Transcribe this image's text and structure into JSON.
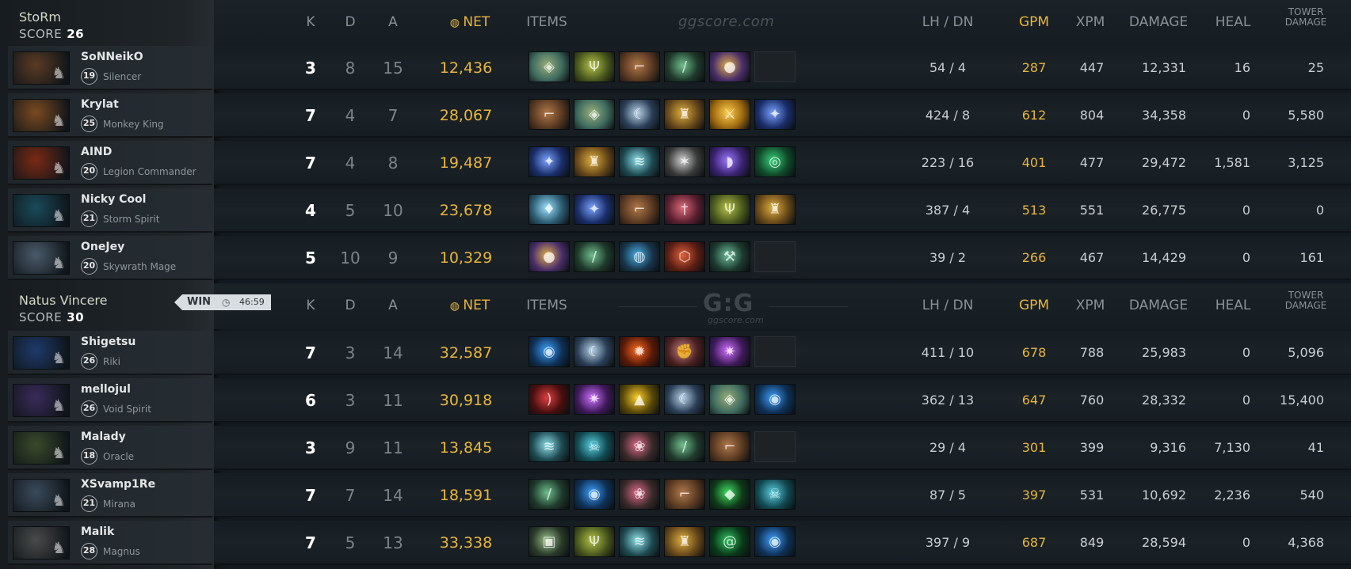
{
  "teams": [
    {
      "name": "StoRm",
      "score_label": "SCORE",
      "score": "26",
      "players": [
        {
          "name": "SoNNeikO",
          "level": "19",
          "hero": "Silencer",
          "k": "3",
          "d": "8",
          "a": "15",
          "net": "12,436",
          "lhdn": "54 / 4",
          "gpm": "287",
          "xpm": "447",
          "damage": "12,331",
          "heal": "16",
          "tower": "25",
          "items": [
            "staff-item-icon",
            "trident-item-icon",
            "boots-item-icon",
            "wand-item-icon",
            "orb-item-icon",
            "empty"
          ]
        },
        {
          "name": "Krylat",
          "level": "25",
          "hero": "Monkey King",
          "k": "7",
          "d": "4",
          "a": "7",
          "net": "28,067",
          "lhdn": "424 / 8",
          "gpm": "612",
          "xpm": "804",
          "damage": "34,358",
          "heal": "0",
          "tower": "5,580",
          "items": [
            "boots-item-icon",
            "staff-item-icon",
            "axe-item-icon",
            "helm-item-icon",
            "sword-item-icon",
            "scepter-item-icon"
          ]
        },
        {
          "name": "AIND",
          "level": "20",
          "hero": "Legion Commander",
          "k": "7",
          "d": "4",
          "a": "8",
          "net": "19,487",
          "lhdn": "223 / 16",
          "gpm": "401",
          "xpm": "477",
          "damage": "29,472",
          "heal": "1,581",
          "tower": "3,125",
          "items": [
            "scepter-item-icon",
            "helm-item-icon",
            "blade-item-icon",
            "wing-item-icon",
            "cloak-item-icon",
            "ring-item-icon"
          ]
        },
        {
          "name": "Nicky Cool",
          "level": "21",
          "hero": "Storm Spirit",
          "k": "4",
          "d": "5",
          "a": "10",
          "net": "23,678",
          "lhdn": "387 / 4",
          "gpm": "513",
          "xpm": "551",
          "damage": "26,775",
          "heal": "0",
          "tower": "0",
          "items": [
            "bottle-item-icon",
            "scepter-item-icon",
            "boots-item-icon",
            "dagger-item-icon",
            "trident-item-icon",
            "helm-item-icon"
          ]
        },
        {
          "name": "OneJey",
          "level": "20",
          "hero": "Skywrath Mage",
          "k": "5",
          "d": "10",
          "a": "9",
          "net": "10,329",
          "lhdn": "39 / 2",
          "gpm": "266",
          "xpm": "467",
          "damage": "14,429",
          "heal": "0",
          "tower": "161",
          "items": [
            "orb-item-icon",
            "wand-item-icon",
            "globe-item-icon",
            "shield-item-icon",
            "hammer-item-icon",
            "empty"
          ]
        }
      ]
    },
    {
      "name": "Natus Vincere",
      "score_label": "SCORE",
      "score": "30",
      "players": [
        {
          "name": "Shigetsu",
          "level": "26",
          "hero": "Riki",
          "k": "7",
          "d": "3",
          "a": "14",
          "net": "32,587",
          "lhdn": "411 / 10",
          "gpm": "678",
          "xpm": "788",
          "damage": "25,983",
          "heal": "0",
          "tower": "5,096",
          "items": [
            "rune-item-icon",
            "axe-item-icon",
            "flame-item-icon",
            "gauntlet-item-icon",
            "star-item-icon",
            "empty"
          ]
        },
        {
          "name": "mellojul",
          "level": "26",
          "hero": "Void Spirit",
          "k": "6",
          "d": "3",
          "a": "11",
          "net": "30,918",
          "lhdn": "362 / 13",
          "gpm": "647",
          "xpm": "760",
          "damage": "28,332",
          "heal": "0",
          "tower": "15,400",
          "items": [
            "bow-item-icon",
            "star-item-icon",
            "cheese-item-icon",
            "axe-item-icon",
            "staff-item-icon",
            "rune-item-icon"
          ]
        },
        {
          "name": "Malady",
          "level": "18",
          "hero": "Oracle",
          "k": "3",
          "d": "9",
          "a": "11",
          "net": "13,845",
          "lhdn": "29 / 4",
          "gpm": "301",
          "xpm": "399",
          "damage": "9,316",
          "heal": "7,130",
          "tower": "41",
          "items": [
            "blade-item-icon",
            "skull-item-icon",
            "lotus-item-icon",
            "wand-item-icon",
            "boots-item-icon",
            "empty"
          ]
        },
        {
          "name": "XSvamp1Re",
          "level": "21",
          "hero": "Mirana",
          "k": "7",
          "d": "7",
          "a": "14",
          "net": "18,591",
          "lhdn": "87 / 5",
          "gpm": "397",
          "xpm": "531",
          "damage": "10,692",
          "heal": "2,236",
          "tower": "540",
          "items": [
            "wand-item-icon",
            "rune-item-icon",
            "lotus-item-icon",
            "boots-item-icon",
            "gem-item-icon",
            "skull-item-icon"
          ]
        },
        {
          "name": "Malik",
          "level": "28",
          "hero": "Magnus",
          "k": "7",
          "d": "5",
          "a": "13",
          "net": "33,338",
          "lhdn": "397 / 9",
          "gpm": "687",
          "xpm": "849",
          "damage": "28,594",
          "heal": "0",
          "tower": "4,368",
          "items": [
            "armor-item-icon",
            "trident-item-icon",
            "blade-item-icon",
            "helm-item-icon",
            "swirl-item-icon",
            "rune-item-icon"
          ]
        }
      ]
    }
  ],
  "headers": {
    "k": "K",
    "d": "D",
    "a": "A",
    "net": "NET",
    "items": "ITEMS",
    "lhdn": "LH  /  DN",
    "gpm": "GPM",
    "xpm": "XPM",
    "damage": "DAMAGE",
    "heal": "HEAL",
    "tower_line1": "TOWER",
    "tower_line2": "DAMAGE"
  },
  "watermark_top": "ggscore.com",
  "watermark_logo": "G:G",
  "watermark_logo_sub": "ggscore.com",
  "win_tag": {
    "label": "WIN",
    "time": "46:59",
    "clock_icon": "clock-icon"
  },
  "net_icon": "gold-coins-icon",
  "colors": {
    "gold": "#e9b53b",
    "kills": "#ffffff",
    "muted": "#7c848a"
  }
}
